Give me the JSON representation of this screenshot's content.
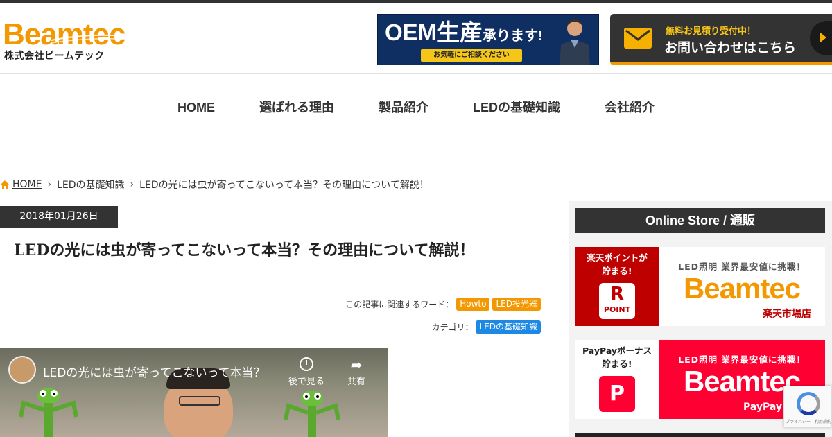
{
  "header": {
    "logo_text": "Beamtec",
    "logo_sub": "株式会社ビームテック",
    "oem_banner": {
      "title_main": "OEM生産",
      "title_small": "承ります!",
      "pill": "お気軽にご相談ください"
    },
    "contact": {
      "small": "無料お見積り受付中！",
      "big": "お問い合わせはこちら"
    }
  },
  "nav": {
    "items": [
      {
        "label": "HOME"
      },
      {
        "label": "選ばれる理由"
      },
      {
        "label": "製品紹介"
      },
      {
        "label": "LEDの基礎知識"
      },
      {
        "label": "会社紹介"
      }
    ]
  },
  "breadcrumb": {
    "home": "HOME",
    "category": "LEDの基礎知識",
    "current": "LEDの光には虫が寄ってこないって本当？その理由について解説！"
  },
  "article": {
    "date": "2018年01月26日",
    "title": "LEDの光には虫が寄ってこないって本当？その理由について解説！",
    "related_label": "この記事に関連するワード：",
    "tags": [
      "Howto",
      "LED投光器"
    ],
    "category_label": "カテゴリ：",
    "category": "LEDの基礎知識"
  },
  "video": {
    "title": "LEDの光には虫が寄ってこないって本当？",
    "watch_later": "後で見る",
    "share": "共有"
  },
  "sidebar": {
    "heading": "Online Store / 通販",
    "promos": [
      {
        "left_text_1": "楽天ポイントが",
        "left_text_2": "貯まる!",
        "logo_letter": "R",
        "logo_word": "POINT",
        "top": "LED照明 業界最安値に挑戦！",
        "brand": "Beamtec",
        "sub": "楽天市場店",
        "left_bg": "#bf0000",
        "right_bg": "#ffffff",
        "brand_color": "#f39800"
      },
      {
        "left_text_1": "PayPayボーナス",
        "left_text_2": "貯まる!",
        "logo_letter": "P",
        "top": "LED照明 業界最安値に挑戦！",
        "brand": "Beamtec",
        "sub": "PayPayモール",
        "left_bg": "#ffffff",
        "right_bg": "#ff0033",
        "brand_color": "#ffffff"
      }
    ]
  },
  "recaptcha": {
    "text": "プライバシー - 利用規約"
  },
  "colors": {
    "accent": "#f39800",
    "dark": "#333333",
    "blue_tag": "#1e88e5"
  }
}
